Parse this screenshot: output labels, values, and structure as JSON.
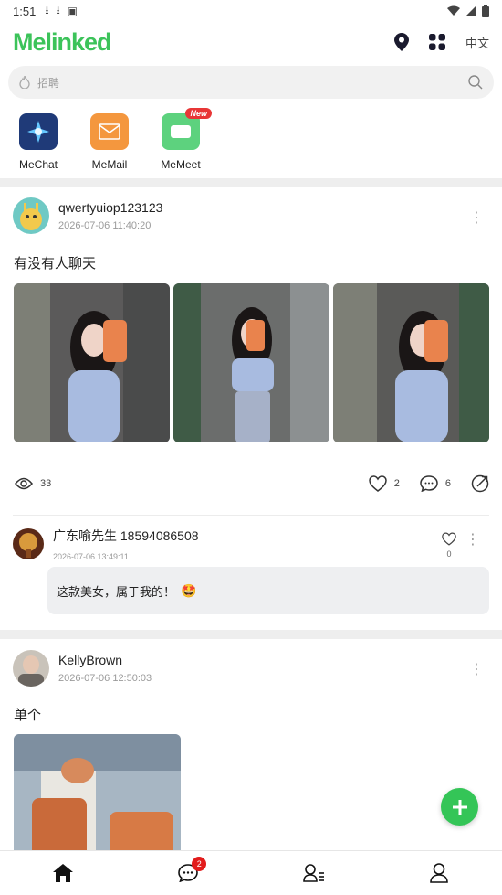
{
  "status_bar": {
    "time": "1:51"
  },
  "header": {
    "logo": "Melinked",
    "lang": "中文"
  },
  "search": {
    "placeholder": "招聘"
  },
  "apps": [
    {
      "label": "MeChat",
      "color": "#1f3a78"
    },
    {
      "label": "MeMail",
      "color": "#f4973e"
    },
    {
      "label": "MeMeet",
      "color": "#5dd27e",
      "badge": "New"
    }
  ],
  "posts": [
    {
      "username": "qwertyuiop123123",
      "timestamp": "2026-07-06 11:40:20",
      "text": "有没有人聊天",
      "views": "33",
      "likes": "2",
      "comments": "6",
      "comment": {
        "username": "广东喻先生 18594086508",
        "timestamp": "2026-07-06 13:49:11",
        "text": "这款美女，属于我的！",
        "emoji": "🤩",
        "likes": "0"
      }
    },
    {
      "username": "KellyBrown",
      "timestamp": "2026-07-06 12:50:03",
      "text": "单个"
    }
  ],
  "bottom_nav": {
    "chat_badge": "2"
  },
  "colors": {
    "brand": "#3cc35a",
    "fab": "#34c557",
    "badge": "#e21c1c"
  }
}
